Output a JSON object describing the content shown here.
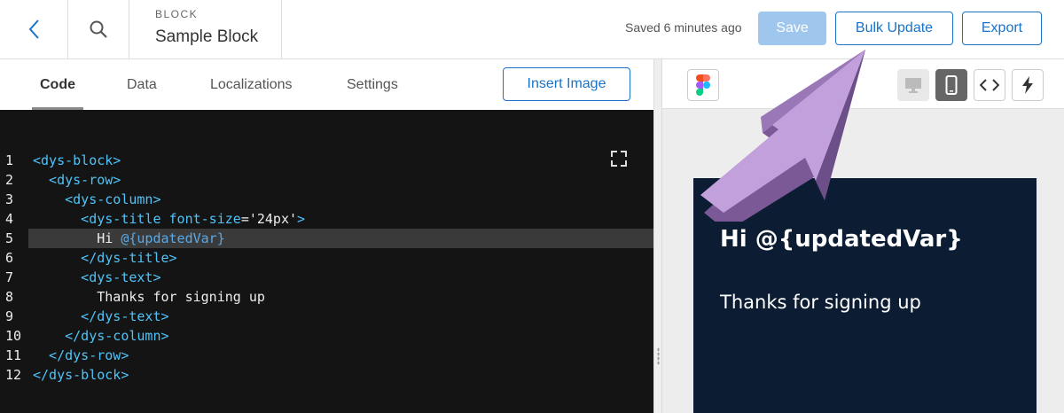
{
  "header": {
    "kicker": "BLOCK",
    "block_name": "Sample Block",
    "saved_status": "Saved 6 minutes ago",
    "save_label": "Save",
    "bulk_update_label": "Bulk Update",
    "export_label": "Export"
  },
  "tabs": [
    {
      "label": "Code",
      "active": true
    },
    {
      "label": "Data",
      "active": false
    },
    {
      "label": "Localizations",
      "active": false
    },
    {
      "label": "Settings",
      "active": false
    }
  ],
  "insert_image_label": "Insert Image",
  "editor": {
    "highlighted_line": 5,
    "lines": [
      {
        "n": "1",
        "parts": [
          {
            "t": "<dys-block>",
            "c": "tagc"
          }
        ]
      },
      {
        "n": "2",
        "parts": [
          {
            "t": "  <dys-row>",
            "c": "tagc"
          }
        ]
      },
      {
        "n": "3",
        "parts": [
          {
            "t": "    <dys-column>",
            "c": "tagc"
          }
        ]
      },
      {
        "n": "4",
        "parts": [
          {
            "t": "      <dys-title ",
            "c": "tagc"
          },
          {
            "t": "font-size",
            "c": "attr"
          },
          {
            "t": "=",
            "c": "str"
          },
          {
            "t": "'24px'",
            "c": "str"
          },
          {
            "t": ">",
            "c": "tagc"
          }
        ]
      },
      {
        "n": "5",
        "parts": [
          {
            "t": "        Hi ",
            "c": "txt"
          },
          {
            "t": "@{updatedVar}",
            "c": "var"
          }
        ]
      },
      {
        "n": "6",
        "parts": [
          {
            "t": "      </dys-title>",
            "c": "tagc"
          }
        ]
      },
      {
        "n": "7",
        "parts": [
          {
            "t": "      <dys-text>",
            "c": "tagc"
          }
        ]
      },
      {
        "n": "8",
        "parts": [
          {
            "t": "        Thanks for signing up",
            "c": "txt"
          }
        ]
      },
      {
        "n": "9",
        "parts": [
          {
            "t": "      </dys-text>",
            "c": "tagc"
          }
        ]
      },
      {
        "n": "10",
        "parts": [
          {
            "t": "    </dys-column>",
            "c": "tagc"
          }
        ]
      },
      {
        "n": "11",
        "parts": [
          {
            "t": "  </dys-row>",
            "c": "tagc"
          }
        ]
      },
      {
        "n": "12",
        "parts": [
          {
            "t": "</dys-block>",
            "c": "tagc"
          }
        ]
      }
    ]
  },
  "preview": {
    "title": "Hi @{updatedVar}",
    "text": "Thanks for signing up",
    "icons": [
      "figma-icon",
      "desktop-icon",
      "mobile-icon",
      "code-icon",
      "bolt-icon"
    ]
  },
  "colors": {
    "accent": "#1a73c8",
    "save_disabled": "#9fc7ee",
    "editor_bg": "#141414",
    "card_bg": "#0c1c33",
    "arrow": "#b48fd0"
  }
}
